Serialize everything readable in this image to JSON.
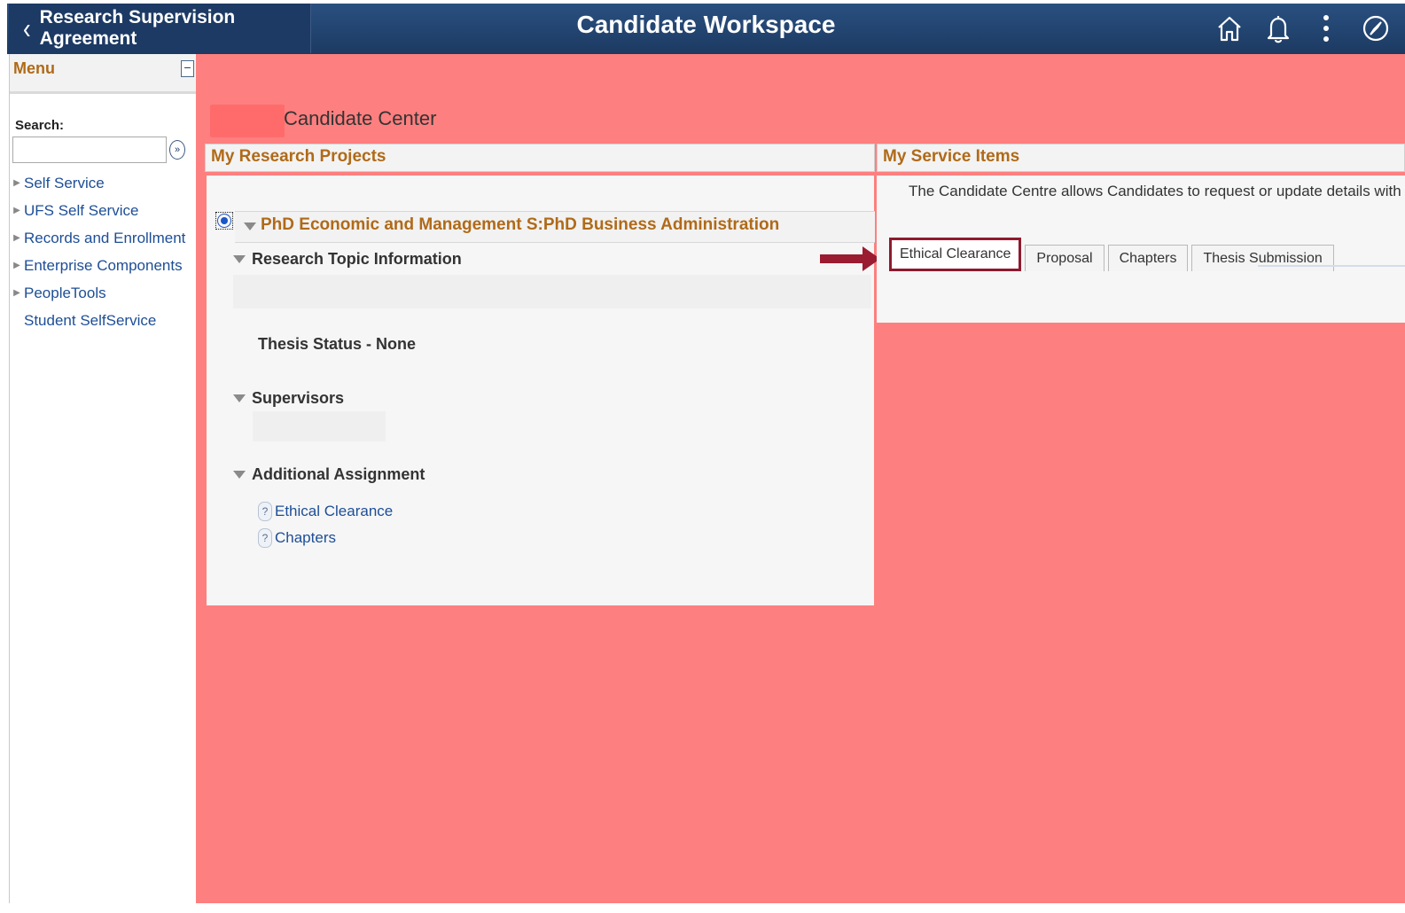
{
  "header": {
    "back_label": "Research Supervision Agreement",
    "title": "Candidate Workspace",
    "icons": [
      "home-icon",
      "bell-icon",
      "more-vertical-icon",
      "compass-icon"
    ]
  },
  "sidebar": {
    "menu_title": "Menu",
    "collapse_symbol": "−",
    "search_label": "Search:",
    "search_value": "",
    "items": [
      {
        "label": "Self Service",
        "expandable": true
      },
      {
        "label": "UFS Self Service",
        "expandable": true
      },
      {
        "label": "Records and Enrollment",
        "expandable": true
      },
      {
        "label": "Enterprise Components",
        "expandable": true
      },
      {
        "label": "PeopleTools",
        "expandable": true
      },
      {
        "label": "Student SelfService",
        "expandable": false
      }
    ]
  },
  "main": {
    "page_title": "Candidate Center",
    "research_projects": {
      "header": "My Research Projects",
      "project_title": "PhD Economic and Management S:PhD Business Administration",
      "research_topic_label": "Research Topic Information",
      "thesis_status": "Thesis Status - None",
      "supervisors_label": "Supervisors",
      "additional_assignment_label": "Additional Assignment",
      "assignments": [
        "Ethical Clearance",
        "Chapters"
      ]
    },
    "service_items": {
      "header": "My Service Items",
      "description": "The Candidate Centre allows Candidates to request or update details with regards to rese",
      "tabs": [
        {
          "label": "Ethical Clearance",
          "active": true
        },
        {
          "label": "Proposal",
          "active": false
        },
        {
          "label": "Chapters",
          "active": false
        },
        {
          "label": "Thesis Submission",
          "active": false
        }
      ]
    }
  },
  "colors": {
    "header_bg": "#20406a",
    "content_bg": "#fe7f7f",
    "heading_orange": "#b06a18",
    "link_blue": "#1d4e96",
    "highlight_maroon": "#8e1a2e"
  }
}
